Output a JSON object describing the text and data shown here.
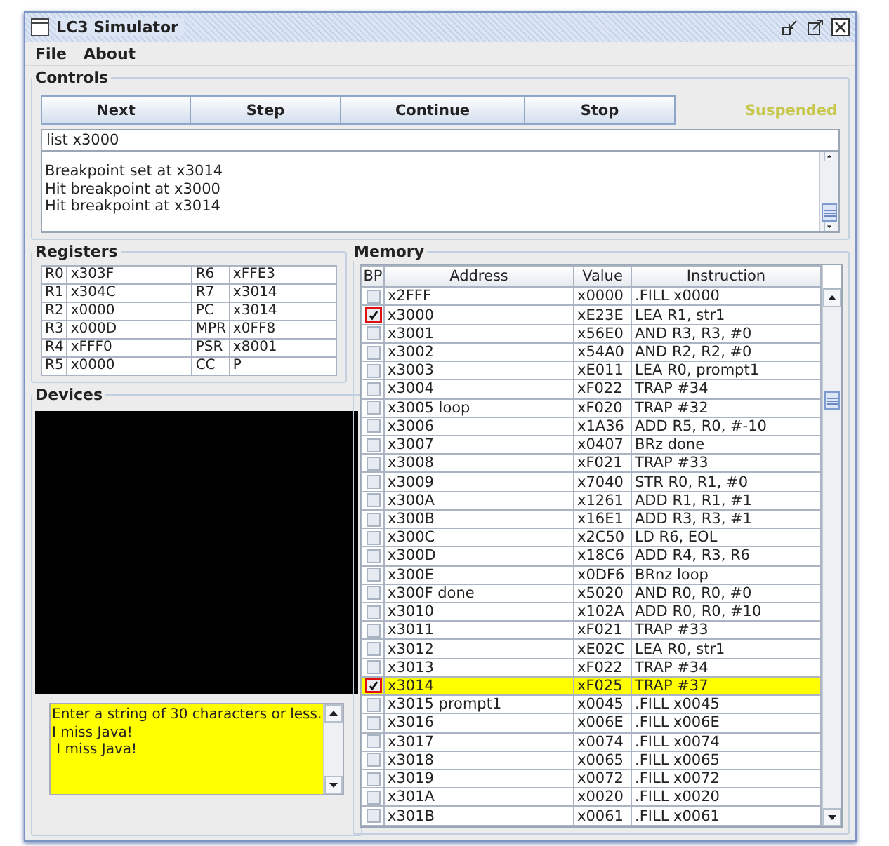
{
  "window": {
    "title": "LC3 Simulator"
  },
  "menu": [
    "File",
    "About"
  ],
  "controls": {
    "title": "Controls",
    "buttons": [
      "Next",
      "Step",
      "Continue",
      "Stop"
    ],
    "status": "Suspended",
    "command": {
      "value": "list x3000"
    },
    "log": [
      "Breakpoint set at x3014",
      "Hit breakpoint at x3000",
      "Hit breakpoint at x3014"
    ]
  },
  "registers": {
    "title": "Registers",
    "rows": [
      {
        "name": "R0",
        "value": "x303F",
        "name_2": "R6",
        "value_2": "xFFE3"
      },
      {
        "name": "R1",
        "value": "x304C",
        "name_2": "R7",
        "value_2": "x3014"
      },
      {
        "name": "R2",
        "value": "x0000",
        "name_2": "PC",
        "value_2": "x3014"
      },
      {
        "name": "R3",
        "value": "x000D",
        "name_2": "MPR",
        "value_2": "x0FF8"
      },
      {
        "name": "R4",
        "value": "xFFF0",
        "name_2": "PSR",
        "value_2": "x8001"
      },
      {
        "name": "R5",
        "value": "x0000",
        "name_2": "CC",
        "value_2": "P"
      }
    ]
  },
  "devices": {
    "title": "Devices",
    "console": [
      "Enter a string of 30 characters or less.",
      "I miss Java!",
      " I miss Java!"
    ]
  },
  "memory": {
    "title": "Memory",
    "columns": [
      "BP",
      "Address",
      "Value",
      "Instruction"
    ],
    "rows": [
      {
        "address": "x2FFF",
        "value": "x0000",
        "instruction": ".FILL x0000",
        "breakpoint": false,
        "selected": false
      },
      {
        "address": "x3000",
        "value": "xE23E",
        "instruction": "LEA R1, str1",
        "breakpoint": true,
        "selected": false
      },
      {
        "address": "x3001",
        "value": "x56E0",
        "instruction": "AND R3, R3, #0",
        "breakpoint": false,
        "selected": false
      },
      {
        "address": "x3002",
        "value": "x54A0",
        "instruction": "AND R2, R2, #0",
        "breakpoint": false,
        "selected": false
      },
      {
        "address": "x3003",
        "value": "xE011",
        "instruction": "LEA R0, prompt1",
        "breakpoint": false,
        "selected": false
      },
      {
        "address": "x3004",
        "value": "xF022",
        "instruction": "TRAP #34",
        "breakpoint": false,
        "selected": false
      },
      {
        "address": "x3005 loop",
        "value": "xF020",
        "instruction": "TRAP #32",
        "breakpoint": false,
        "selected": false
      },
      {
        "address": "x3006",
        "value": "x1A36",
        "instruction": "ADD R5, R0, #-10",
        "breakpoint": false,
        "selected": false
      },
      {
        "address": "x3007",
        "value": "x0407",
        "instruction": "BRz done",
        "breakpoint": false,
        "selected": false
      },
      {
        "address": "x3008",
        "value": "xF021",
        "instruction": "TRAP #33",
        "breakpoint": false,
        "selected": false
      },
      {
        "address": "x3009",
        "value": "x7040",
        "instruction": "STR R0, R1, #0",
        "breakpoint": false,
        "selected": false
      },
      {
        "address": "x300A",
        "value": "x1261",
        "instruction": "ADD R1, R1, #1",
        "breakpoint": false,
        "selected": false
      },
      {
        "address": "x300B",
        "value": "x16E1",
        "instruction": "ADD R3, R3, #1",
        "breakpoint": false,
        "selected": false
      },
      {
        "address": "x300C",
        "value": "x2C50",
        "instruction": "LD R6, EOL",
        "breakpoint": false,
        "selected": false
      },
      {
        "address": "x300D",
        "value": "x18C6",
        "instruction": "ADD R4, R3, R6",
        "breakpoint": false,
        "selected": false
      },
      {
        "address": "x300E",
        "value": "x0DF6",
        "instruction": "BRnz loop",
        "breakpoint": false,
        "selected": false
      },
      {
        "address": "x300F done",
        "value": "x5020",
        "instruction": "AND R0, R0, #0",
        "breakpoint": false,
        "selected": false
      },
      {
        "address": "x3010",
        "value": "x102A",
        "instruction": "ADD R0, R0, #10",
        "breakpoint": false,
        "selected": false
      },
      {
        "address": "x3011",
        "value": "xF021",
        "instruction": "TRAP #33",
        "breakpoint": false,
        "selected": false
      },
      {
        "address": "x3012",
        "value": "xE02C",
        "instruction": "LEA R0, str1",
        "breakpoint": false,
        "selected": false
      },
      {
        "address": "x3013",
        "value": "xF022",
        "instruction": "TRAP #34",
        "breakpoint": false,
        "selected": false
      },
      {
        "address": "x3014",
        "value": "xF025",
        "instruction": "TRAP #37",
        "breakpoint": true,
        "selected": true
      },
      {
        "address": "x3015 prompt1",
        "value": "x0045",
        "instruction": ".FILL x0045",
        "breakpoint": false,
        "selected": false
      },
      {
        "address": "x3016",
        "value": "x006E",
        "instruction": ".FILL x006E",
        "breakpoint": false,
        "selected": false
      },
      {
        "address": "x3017",
        "value": "x0074",
        "instruction": ".FILL x0074",
        "breakpoint": false,
        "selected": false
      },
      {
        "address": "x3018",
        "value": "x0065",
        "instruction": ".FILL x0065",
        "breakpoint": false,
        "selected": false
      },
      {
        "address": "x3019",
        "value": "x0072",
        "instruction": ".FILL x0072",
        "breakpoint": false,
        "selected": false
      },
      {
        "address": "x301A",
        "value": "x0020",
        "instruction": ".FILL x0020",
        "breakpoint": false,
        "selected": false
      },
      {
        "address": "x301B",
        "value": "x0061",
        "instruction": ".FILL x0061",
        "breakpoint": false,
        "selected": false
      }
    ]
  }
}
